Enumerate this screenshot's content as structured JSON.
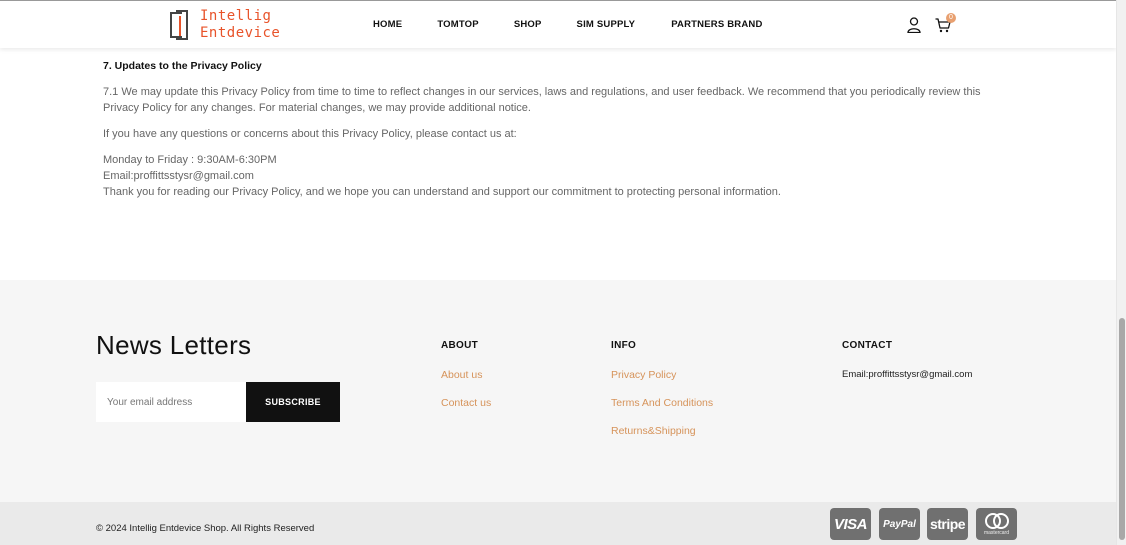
{
  "header": {
    "logo_line1": "Intellig",
    "logo_line2": "Entdevice",
    "nav": [
      "HOME",
      "TOMTOP",
      "SHOP",
      "SIM SUPPLY",
      "PARTNERS BRAND"
    ],
    "cart_count": "0",
    "icons": {
      "user": "user-icon",
      "cart": "cart-icon"
    },
    "accent_color": "#e8532a"
  },
  "content": {
    "heading": "7. Updates to the Privacy Policy",
    "para1": "7.1 We may update this Privacy Policy from time to time to reflect changes in our services, laws and regulations, and user feedback. We recommend that you periodically review this Privacy Policy for any changes. For material changes, we may provide additional notice.",
    "para2": "If you have any questions or concerns about this Privacy Policy, please contact us at:",
    "hours": "Monday to Friday : 9:30AM-6:30PM",
    "email": "Email:proffittsstysr@gmail.com",
    "thanks": "Thank you for reading our Privacy Policy, and we hope you can understand and support our commitment to protecting personal information."
  },
  "footer": {
    "newsletter_title": "News Letters",
    "email_placeholder": "Your email address",
    "subscribe_label": "SUBSCRIBE",
    "about": {
      "title": "ABOUT",
      "links": [
        "About us",
        "Contact us"
      ]
    },
    "info": {
      "title": "INFO",
      "links": [
        "Privacy Policy",
        "Terms And Conditions",
        "Returns&Shipping"
      ]
    },
    "contact": {
      "title": "CONTACT",
      "email": "Email:proffittsstysr@gmail.com"
    },
    "link_color": "#d6935a"
  },
  "bottom": {
    "copyright": "© 2024 Intellig Entdevice Shop. All Rights Reserved",
    "payments": {
      "visa": "VISA",
      "paypal": "PayPal",
      "stripe": "stripe",
      "mastercard": "mastercard"
    }
  }
}
